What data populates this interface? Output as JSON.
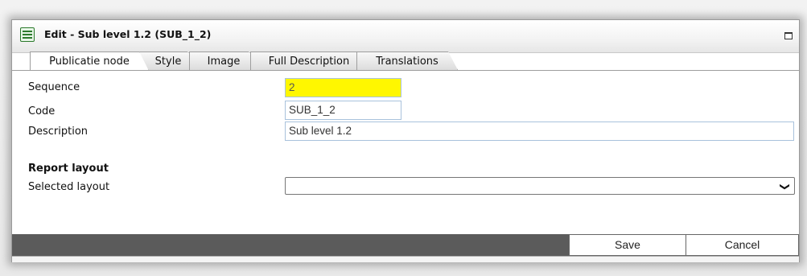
{
  "window": {
    "title": "Edit - Sub level 1.2 (SUB_1_2)",
    "icon": "form-icon",
    "maximize_icon": "maximize-icon"
  },
  "tabs": [
    {
      "label": "Publicatie node",
      "active": true
    },
    {
      "label": "Style",
      "active": false
    },
    {
      "label": "Image",
      "active": false
    },
    {
      "label": "Full Description",
      "active": false
    },
    {
      "label": "Translations",
      "active": false
    }
  ],
  "form": {
    "sequence": {
      "label": "Sequence",
      "value": "2"
    },
    "code": {
      "label": "Code",
      "value": "SUB_1_2"
    },
    "description": {
      "label": "Description",
      "value": "Sub level 1.2"
    }
  },
  "report_layout": {
    "section_title": "Report layout",
    "selected_layout_label": "Selected layout",
    "selected_layout_value": ""
  },
  "footer": {
    "save_label": "Save",
    "cancel_label": "Cancel"
  },
  "colors": {
    "highlight_field": "#fff700",
    "footer_bar": "#5b5b5b"
  }
}
